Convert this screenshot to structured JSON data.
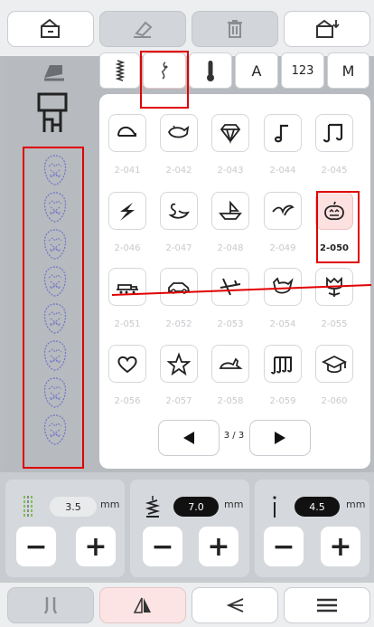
{
  "toolbar": {
    "buttons": [
      {
        "icon": "home-icon"
      },
      {
        "icon": "eraser-icon"
      },
      {
        "icon": "trash-icon"
      },
      {
        "icon": "import-icon"
      }
    ]
  },
  "categories": {
    "tabs": [
      {
        "label": "",
        "icon": "zigzag-stitch-icon"
      },
      {
        "label": "",
        "icon": "decorative-stitch-icon"
      },
      {
        "label": "",
        "icon": "thermometer-icon"
      },
      {
        "label": "A"
      },
      {
        "label": "123"
      },
      {
        "label": "M"
      }
    ],
    "selected_index": 1
  },
  "stitches": [
    {
      "code": "2-041",
      "icon": "duck-icon"
    },
    {
      "code": "2-042",
      "icon": "whale-icon"
    },
    {
      "code": "2-043",
      "icon": "diamond-icon"
    },
    {
      "code": "2-044",
      "icon": "music-note-icon"
    },
    {
      "code": "2-045",
      "icon": "double-note-icon"
    },
    {
      "code": "2-046",
      "icon": "lightning-icon"
    },
    {
      "code": "2-047",
      "icon": "swan-icon"
    },
    {
      "code": "2-048",
      "icon": "boat-icon"
    },
    {
      "code": "2-049",
      "icon": "bird-icon"
    },
    {
      "code": "2-050",
      "icon": "pumpkin-icon"
    },
    {
      "code": "2-051",
      "icon": "train-icon"
    },
    {
      "code": "2-052",
      "icon": "car-icon"
    },
    {
      "code": "2-053",
      "icon": "airplane-icon"
    },
    {
      "code": "2-054",
      "icon": "cat-icon"
    },
    {
      "code": "2-055",
      "icon": "tulip-icon"
    },
    {
      "code": "2-056",
      "icon": "heart-icon"
    },
    {
      "code": "2-057",
      "icon": "star-icon"
    },
    {
      "code": "2-058",
      "icon": "rabbit-icon"
    },
    {
      "code": "2-059",
      "icon": "music-bars-icon"
    },
    {
      "code": "2-060",
      "icon": "graduation-cap-icon"
    }
  ],
  "selected_code": "2-050",
  "pagination": {
    "page_label": "3 / 3"
  },
  "controls": {
    "width": {
      "value": "3.5",
      "unit": "mm"
    },
    "length": {
      "value": "7.0",
      "unit": "mm"
    },
    "tension": {
      "value": "4.5",
      "unit": "mm"
    }
  },
  "nav": {
    "buttons": [
      {
        "icon": "twin-needle-icon"
      },
      {
        "icon": "mirror-icon"
      },
      {
        "icon": "reverse-icon"
      },
      {
        "icon": "menu-icon"
      }
    ]
  },
  "colors": {
    "accent_red": "#e00000",
    "selected_bg": "#fde0e0",
    "pill_dark": "#111111"
  }
}
